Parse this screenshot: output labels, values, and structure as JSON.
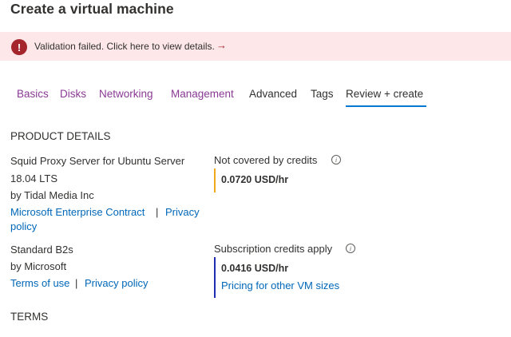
{
  "page": {
    "title": "Create a virtual machine"
  },
  "alert": {
    "text": "Validation failed. Click here to view details.",
    "arrow": "→",
    "icon": "!",
    "color": "#a4262c",
    "background": "#fde7e9"
  },
  "tabs": [
    {
      "label": "Basics"
    },
    {
      "label": "Disks"
    },
    {
      "label": "Networking"
    },
    {
      "label": "Management"
    },
    {
      "label": "Advanced"
    },
    {
      "label": "Tags"
    },
    {
      "label": "Review + create",
      "active": true
    }
  ],
  "product_details": {
    "heading": "PRODUCT DETAILS",
    "items": [
      {
        "name_line1": "Squid Proxy Server for Ubuntu Server",
        "name_line2": "18.04 LTS",
        "publisher": "by Tidal Media Inc",
        "link1": "Microsoft Enterprise Contract",
        "separator": "|",
        "link2_line1": "Privacy",
        "link2_line2": "policy",
        "price_label": "Not covered by credits",
        "price": "0.0720 USD/hr",
        "bar_color": "#f2a81d"
      },
      {
        "name_line1": "Standard B2s",
        "publisher": "by Microsoft",
        "link1": "Terms of use",
        "separator": "|",
        "link2": "Privacy policy",
        "price_label": "Subscription credits apply",
        "price": "0.0416 USD/hr",
        "price_link": "Pricing for other VM sizes",
        "bar_color": "#1f2bb3"
      }
    ]
  },
  "terms": {
    "heading": "TERMS"
  },
  "colors": {
    "link": "#0067b8",
    "tab_link": "#8a3a94",
    "tab_underline": "#0078d4"
  }
}
